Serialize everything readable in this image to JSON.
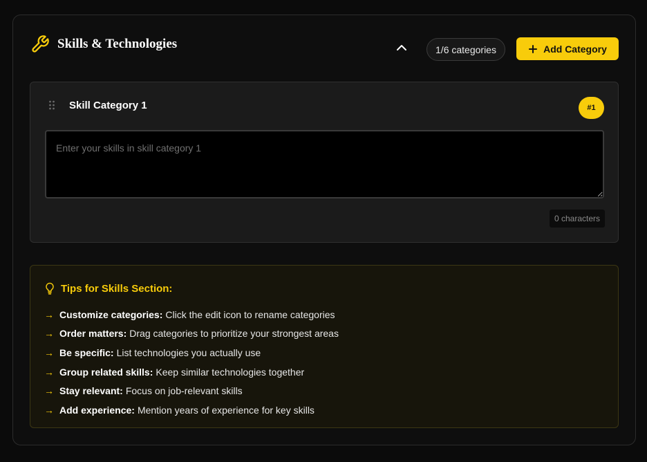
{
  "header": {
    "title": "Skills & Technologies",
    "category_count": "1/6 categories",
    "add_label": "Add Category"
  },
  "category": {
    "name": "Skill Category 1",
    "badge": "#1",
    "value": "",
    "placeholder": "Enter your skills in skill category 1",
    "char_count": "0 characters"
  },
  "tips": {
    "title": "Tips for Skills Section:",
    "arrow": "→",
    "items": [
      {
        "label": "Customize categories:",
        "text": "Click the edit icon to rename categories"
      },
      {
        "label": "Order matters:",
        "text": "Drag categories to prioritize your strongest areas"
      },
      {
        "label": "Be specific:",
        "text": "List technologies you actually use"
      },
      {
        "label": "Group related skills:",
        "text": "Keep similar technologies together"
      },
      {
        "label": "Stay relevant:",
        "text": "Focus on job-relevant skills"
      },
      {
        "label": "Add experience:",
        "text": "Mention years of experience for key skills"
      }
    ]
  },
  "icons": {
    "header": "wrench-icon",
    "collapse": "chevron-up-icon",
    "add": "plus-icon",
    "drag": "drag-handle-icon",
    "tips": "lightbulb-icon"
  },
  "colors": {
    "accent": "#f8cc0b",
    "background": "#0b0b0b",
    "card": "#1b1b1b",
    "tips_background": "#17150b"
  }
}
